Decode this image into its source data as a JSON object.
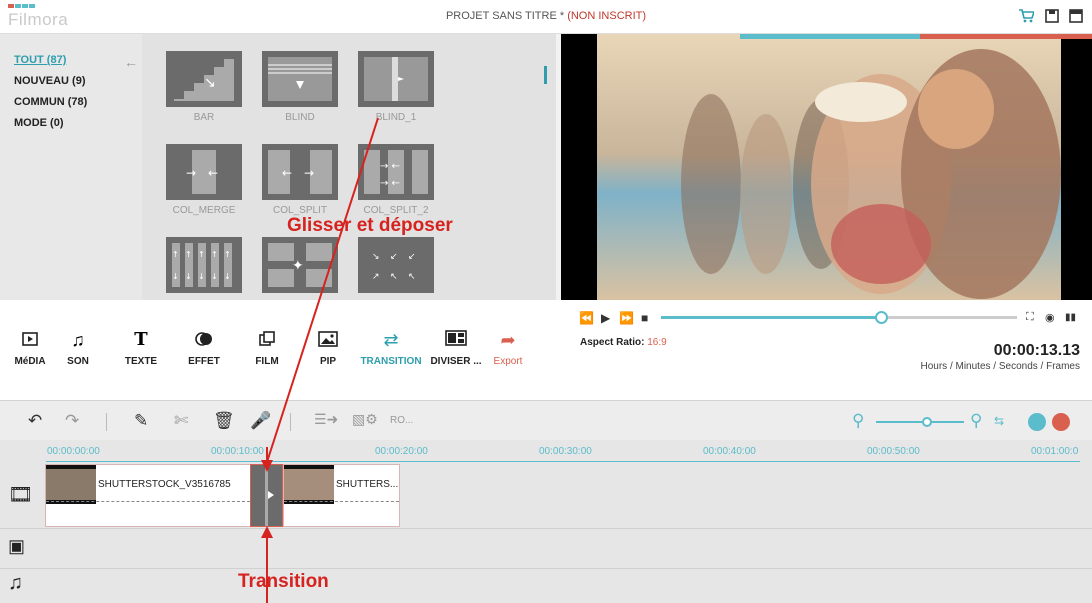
{
  "app": {
    "logo": "Filmora",
    "title_main": "PROJET SANS TITRE *",
    "title_status": "(NON INSCRIT)"
  },
  "titlebar_icons": [
    "cart-icon",
    "save-icon",
    "window-icon"
  ],
  "categories": [
    {
      "label": "TOUT (87)",
      "active": true
    },
    {
      "label": "NOUVEAU (9)",
      "active": false
    },
    {
      "label": "COMMUN (78)",
      "active": false
    },
    {
      "label": "MODE (0)",
      "active": false
    }
  ],
  "transitions": [
    {
      "label": "BAR"
    },
    {
      "label": "BLIND"
    },
    {
      "label": "BLIND_1"
    },
    {
      "label": "COL_MERGE"
    },
    {
      "label": "COL_SPLIT"
    },
    {
      "label": "COL_SPLIT_2"
    },
    {
      "label": ""
    },
    {
      "label": ""
    },
    {
      "label": ""
    }
  ],
  "tools": [
    {
      "label": "MéDIA",
      "icon": "media-icon"
    },
    {
      "label": "SON",
      "icon": "music-icon"
    },
    {
      "label": "TEXTE",
      "icon": "text-icon"
    },
    {
      "label": "EFFET",
      "icon": "effect-icon"
    },
    {
      "label": "FILM",
      "icon": "film-icon"
    },
    {
      "label": "PIP",
      "icon": "pip-icon"
    },
    {
      "label": "TRANSITION",
      "icon": "transition-icon",
      "active": true
    },
    {
      "label": "DIVISER ...",
      "icon": "split-screen-icon"
    },
    {
      "label": "Export",
      "icon": "export-icon",
      "accent": true
    }
  ],
  "player": {
    "progress": 0.62,
    "aspect_label": "Aspect Ratio:",
    "aspect_value": "16:9",
    "timecode": "00:00:13.13",
    "timecode_units": "Hours / Minutes / Seconds / Frames"
  },
  "edit_bar": {
    "record_label": "RO...",
    "zoom": 0.58
  },
  "timeline": {
    "ticks": [
      "00:00:00:00",
      "00:00:10:00",
      "00:00:20:00",
      "00:00:30:00",
      "00:00:40:00",
      "00:00:50:00",
      "00:01:00:0"
    ],
    "clips": [
      {
        "name": "SHUTTERSTOCK_V3516785"
      },
      {
        "name": "SHUTTERS..."
      }
    ]
  },
  "annotations": {
    "drag_label": "Glisser et déposer",
    "transition_label": "Transition"
  },
  "colors": {
    "accent": "#5bbccb",
    "red": "#d9604e",
    "annotation": "#d6231f"
  }
}
